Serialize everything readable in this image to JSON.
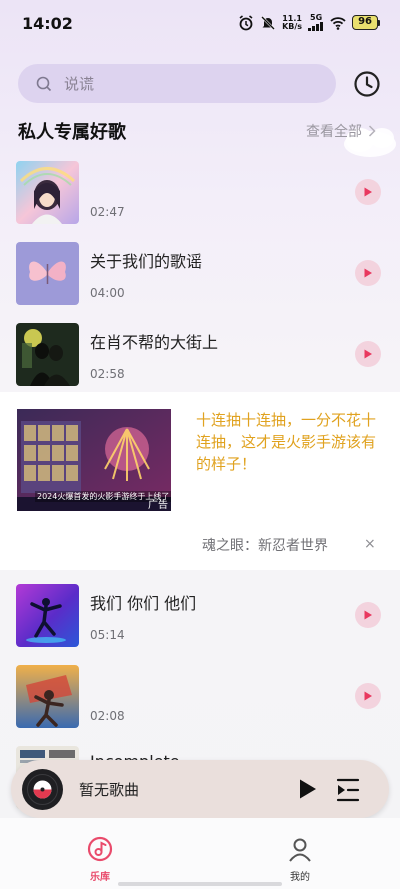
{
  "status_bar": {
    "time": "14:02",
    "net_speed_value": "11.1",
    "net_speed_unit": "KB/s",
    "signal_label": "5G",
    "battery": "96"
  },
  "search": {
    "placeholder": "说谎"
  },
  "section": {
    "title": "私人专属好歌",
    "view_all": "查看全部"
  },
  "songs": [
    {
      "title": "",
      "duration": "02:47"
    },
    {
      "title": "关于我们的歌谣",
      "duration": "04:00"
    },
    {
      "title": "在肖不帮的大街上",
      "duration": "02:58"
    },
    {
      "title": "我们 你们 他们",
      "duration": "05:14"
    },
    {
      "title": "",
      "duration": "02:08"
    },
    {
      "title": "Incomplete",
      "duration": ""
    }
  ],
  "ad": {
    "caption": "2024火爆首发的火影手游终于上线了",
    "tag": "广告",
    "text": "十连抽十连抽，一分不花十连抽，这才是火影手游该有的样子！",
    "source": "魂之眼：新忍者世界",
    "close": "×"
  },
  "mini_player": {
    "title": "暂无歌曲"
  },
  "bottom_nav": {
    "library": "乐库",
    "me": "我的"
  },
  "colors": {
    "accent": "#e94a6b",
    "ad_text": "#e0a21f",
    "search_bg": "#ddd3ef"
  }
}
